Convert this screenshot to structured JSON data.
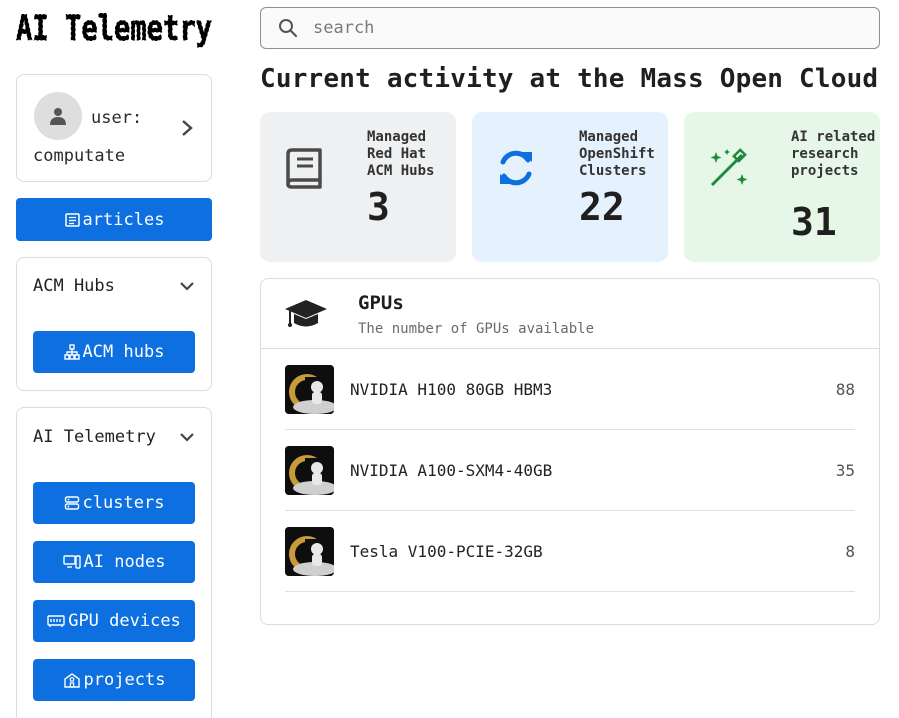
{
  "logo": {
    "text": "AI Telemetry"
  },
  "search": {
    "placeholder": "search"
  },
  "sidebar": {
    "user_label": "user: computate",
    "articles_label": "articles",
    "groups": [
      {
        "title": "ACM Hubs",
        "items": [
          {
            "label": "ACM hubs",
            "icon": "sitemap-icon"
          }
        ]
      },
      {
        "title": "AI Telemetry",
        "items": [
          {
            "label": "clusters",
            "icon": "server-icon"
          },
          {
            "label": "AI nodes",
            "icon": "computer-icon"
          },
          {
            "label": "GPU devices",
            "icon": "memory-icon"
          },
          {
            "label": "projects",
            "icon": "school-icon"
          }
        ]
      }
    ]
  },
  "main": {
    "heading": "Current activity at the Mass Open Cloud",
    "stats": [
      {
        "label": "Managed Red Hat ACM Hubs",
        "value": "3",
        "icon": "book-icon",
        "color": "#4a4a4a"
      },
      {
        "label": "Managed OpenShift Clusters",
        "value": "22",
        "icon": "sync-icon",
        "color": "#0d6fe0"
      },
      {
        "label": "AI related research projects",
        "value": "31",
        "icon": "magic-wand-icon",
        "color": "#1e8a3c"
      }
    ],
    "gpus": {
      "title": "GPUs",
      "subtitle": "The number of GPUs available",
      "rows": [
        {
          "name": "NVIDIA H100 80GB HBM3",
          "count": "88"
        },
        {
          "name": "NVIDIA A100-SXM4-40GB",
          "count": "35"
        },
        {
          "name": "Tesla V100-PCIE-32GB",
          "count": "8"
        }
      ]
    }
  },
  "colors": {
    "primary": "#0d6fe0",
    "stat_gray": "#eef0f2",
    "stat_blue": "#e6f1fe",
    "stat_green": "#e6f7e8"
  }
}
